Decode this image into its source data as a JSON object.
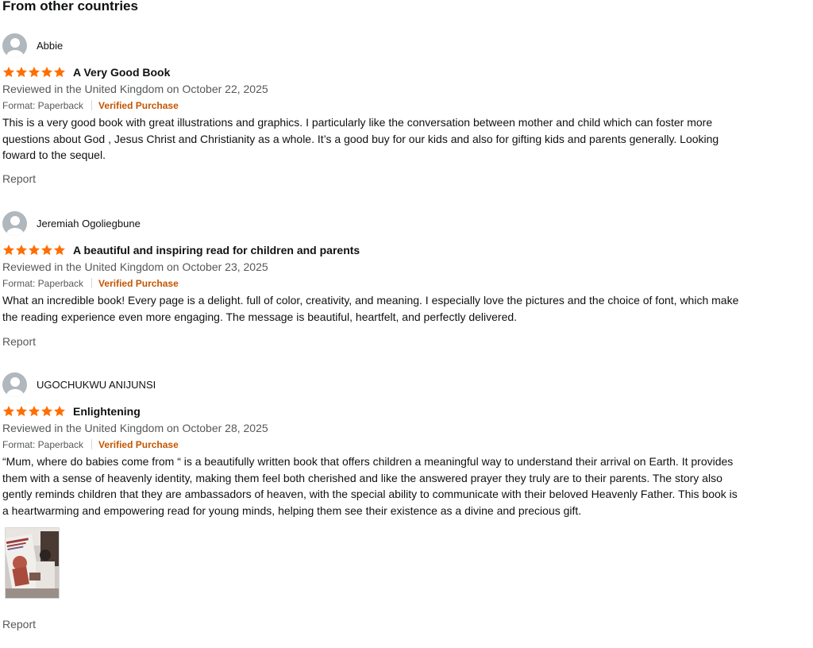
{
  "section": {
    "title": "From other countries"
  },
  "reviews": [
    {
      "reviewer": "Abbie",
      "rating": 5,
      "title": "A Very Good Book",
      "date": "Reviewed in the United Kingdom on October 22, 2025",
      "format": "Format: Paperback",
      "verified": "Verified Purchase",
      "body": "This is a very good book with great illustrations and graphics. I particularly like the conversation between mother and child which can foster more questions about God , Jesus Christ and Christianity as a whole. It’s a good buy for our kids and also for gifting kids and parents generally. Looking foward to the sequel.",
      "report": "Report"
    },
    {
      "reviewer": "Jeremiah Ogoliegbune",
      "rating": 5,
      "title": "A beautiful and inspiring read for children and parents",
      "date": "Reviewed in the United Kingdom on October 23, 2025",
      "format": "Format: Paperback",
      "verified": "Verified Purchase",
      "body": "What an incredible book! Every page is a delight. full of color, creativity, and meaning. I especially love the pictures and the choice of font, which make the reading experience even more engaging. The message is beautiful, heartfelt, and perfectly delivered.",
      "report": "Report"
    },
    {
      "reviewer": "UGOCHUKWU ANIJUNSI",
      "rating": 5,
      "title": "Enlightening",
      "date": "Reviewed in the United Kingdom on October 28, 2025",
      "format": "Format: Paperback",
      "verified": "Verified Purchase",
      "body": "“Mum, where do babies come from “ is a beautifully written book that offers children a meaningful way to understand their arrival on Earth. It provides them with a sense of heavenly identity, making them feel both cherished and like the answered prayer they truly are to their parents. The story also gently reminds children that they are ambassadors of heaven, with the special ability to communicate with their beloved Heavenly Father. This book is a heartwarming and empowering read for young minds, helping them see their existence as a divine and precious gift.",
      "report": "Report"
    }
  ],
  "colors": {
    "star": "#ff6e00",
    "verified": "#c45500",
    "muted": "#565959",
    "text": "#0f1111",
    "avatar": "#b0b7bd"
  },
  "icons": {
    "avatar": "avatar-icon",
    "star": "star-icon"
  }
}
